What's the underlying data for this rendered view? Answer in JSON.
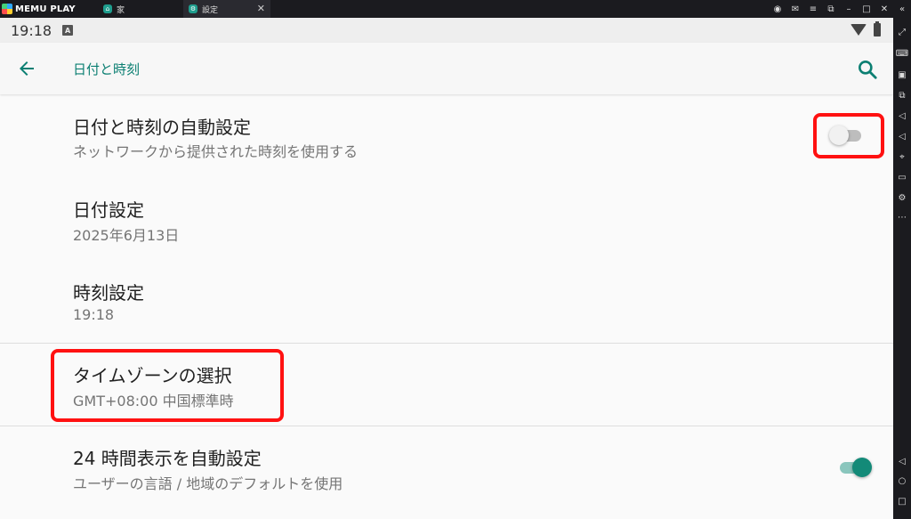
{
  "emulator": {
    "brand": "MEMU PLAY",
    "tabs": [
      {
        "label": "家",
        "icon": "home-app-icon"
      },
      {
        "label": "設定",
        "icon": "settings-app-icon"
      }
    ],
    "title_controls": [
      "account-icon",
      "mail-icon",
      "menu-icon",
      "restore-icon",
      "minimize-icon",
      "maximize-icon",
      "close-icon",
      "collapse-icon"
    ],
    "side_tools": [
      "fullscreen-icon",
      "keyboard-icon",
      "apk-icon",
      "multi-window-icon",
      "volume-up-icon",
      "volume-down-icon",
      "location-icon",
      "folder-icon",
      "settings-icon",
      "more-icon",
      "android-back-icon",
      "android-home-icon",
      "android-recents-icon"
    ]
  },
  "status": {
    "time": "19:18",
    "badge": "A"
  },
  "appbar": {
    "title": "日付と時刻"
  },
  "items": [
    {
      "title": "日付と時刻の自動設定",
      "subtitle": "ネットワークから提供された時刻を使用する",
      "switch": "off"
    },
    {
      "title": "日付設定",
      "subtitle": "2025年6月13日"
    },
    {
      "title": "時刻設定",
      "subtitle": "19:18"
    },
    {
      "title": "タイムゾーンの選択",
      "subtitle": "GMT+08:00 中国標準時"
    },
    {
      "title": "24 時間表示を自動設定",
      "subtitle": "ユーザーの言語 / 地域のデフォルトを使用",
      "switch": "on"
    }
  ],
  "colors": {
    "accent": "#138a78",
    "title_accent": "#0b7f72",
    "highlight": "#ff1111"
  }
}
